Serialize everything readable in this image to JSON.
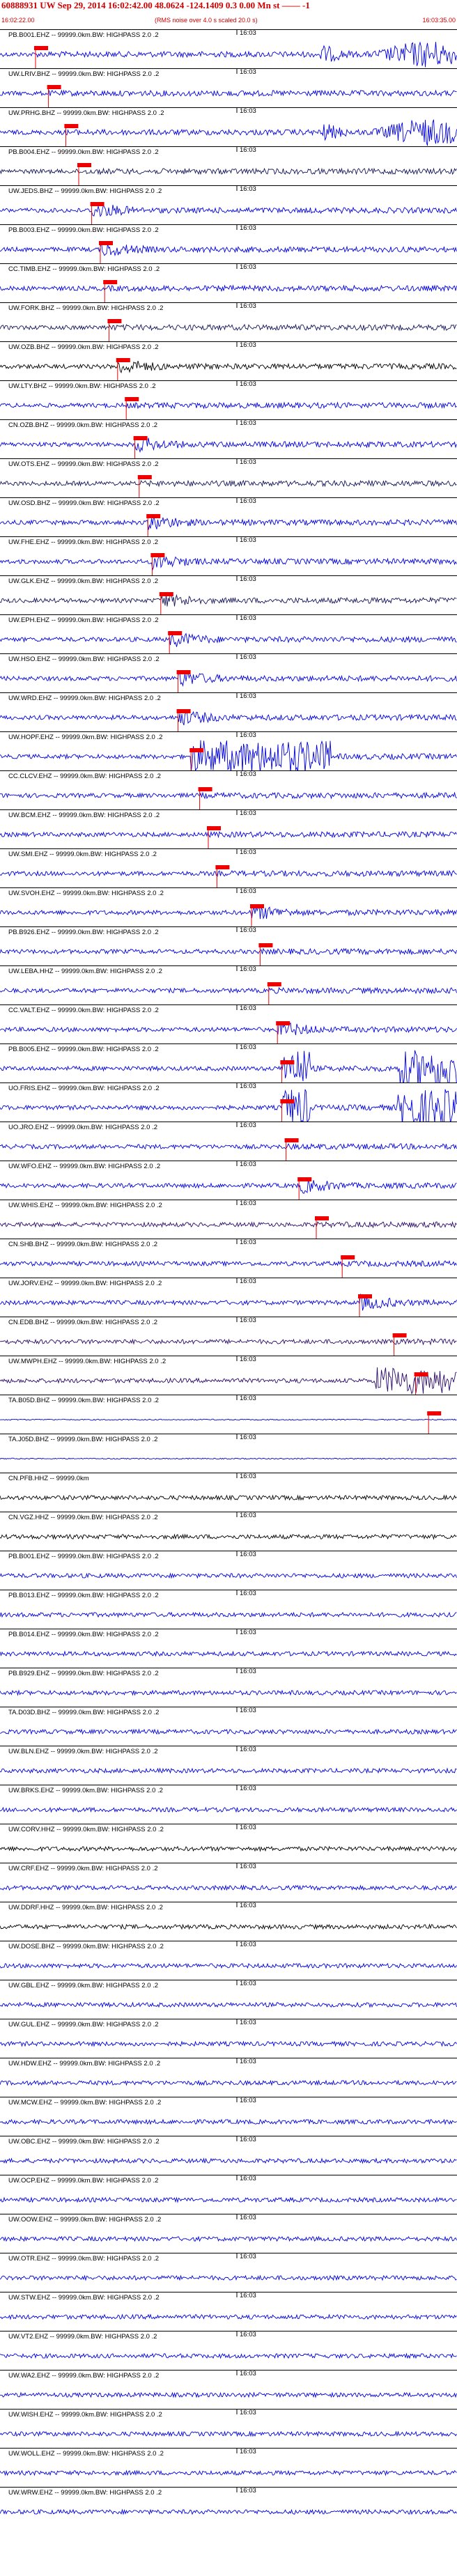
{
  "header": {
    "event_line": "60888931 UW Sep 29, 2014 16:02:42.00   48.0624 -124.1409  0.3 0.00 Mn st  —— -1",
    "right_mark": "-1",
    "start_time": "16:02:22.00",
    "note": "(RMS noise over 4.0 s scaled 20.0 s)",
    "end_time": "16:03:35.00"
  },
  "colors": {
    "header_red": "#cc0000",
    "pick_red": "#ee0000",
    "trace_blue": "#0000dd",
    "trace_navy": "#14145a",
    "trace_black": "#000000",
    "trace_purple": "#2a0a6a"
  },
  "traces": [
    {
      "label": "PB.B001.EHZ -- 99999.0km.BW: HIGHPASS 2.0 .2",
      "time": "16:03",
      "pick": 0.05,
      "color": "#0000dd",
      "activity": "strong-late"
    },
    {
      "label": "UW.LRIV.BHZ -- 99999.0km.BW: HIGHPASS 2.0 .2",
      "time": "16:03",
      "pick": 0.08,
      "color": "#0000dd",
      "activity": "noise"
    },
    {
      "label": "UW.PRHG.BHZ -- 99999.0km.BW: HIGHPASS 2.0 .2",
      "time": "16:03",
      "pick": 0.12,
      "color": "#0000dd",
      "activity": "strong-late"
    },
    {
      "label": "PB.B004.EHZ -- 99999.0km.BW: HIGHPASS 2.0 .2",
      "time": "16:03",
      "pick": 0.15,
      "color": "#14145a",
      "activity": "noise"
    },
    {
      "label": "UW.JEDS.BHZ -- 99999.0km.BW: HIGHPASS 2.0 .2",
      "time": "16:03",
      "pick": 0.18,
      "color": "#0000dd",
      "activity": "moderate"
    },
    {
      "label": "PB.B003.EHZ -- 99999.0km.BW: HIGHPASS 2.0 .2",
      "time": "16:03",
      "pick": 0.2,
      "color": "#0000dd",
      "activity": "moderate"
    },
    {
      "label": "CC.TIMB.EHZ -- 99999.0km.BW: HIGHPASS 2.0 .2",
      "time": "16:03",
      "pick": 0.21,
      "color": "#0000dd",
      "activity": "noise"
    },
    {
      "label": "UW.FORK.BHZ -- 99999.0km.BW: HIGHPASS 2.0 .2",
      "time": "16:03",
      "pick": 0.22,
      "color": "#14145a",
      "activity": "noise"
    },
    {
      "label": "UW.OZB.BHZ -- 99999.0km.BW: HIGHPASS 2.0 .2",
      "time": "16:03",
      "pick": 0.24,
      "color": "#000000",
      "activity": "moderate"
    },
    {
      "label": "UW.LTY.BHZ -- 99999.0km.BW: HIGHPASS 2.0 .2",
      "time": "16:03",
      "pick": 0.26,
      "color": "#0000dd",
      "activity": "noise"
    },
    {
      "label": "CN.OZB.BHZ -- 99999.0km.BW: HIGHPASS 2.0 .2",
      "time": "16:03",
      "pick": 0.28,
      "color": "#0000dd",
      "activity": "moderate"
    },
    {
      "label": "UW.OTS.EHZ -- 99999.0km.BW: HIGHPASS 2.0 .2",
      "time": "16:03",
      "pick": 0.29,
      "color": "#14145a",
      "activity": "noise"
    },
    {
      "label": "UW.OSD.BHZ -- 99999.0km.BW: HIGHPASS 2.0 .2",
      "time": "16:03",
      "pick": 0.31,
      "color": "#0000dd",
      "activity": "moderate"
    },
    {
      "label": "UW.FHE.EHZ -- 99999.0km.BW: HIGHPASS 2.0 .2",
      "time": "16:03",
      "pick": 0.32,
      "color": "#0000dd",
      "activity": "moderate"
    },
    {
      "label": "UW.GLK.EHZ -- 99999.0km.BW: HIGHPASS 2.0 .2",
      "time": "16:03",
      "pick": 0.34,
      "color": "#14145a",
      "activity": "moderate"
    },
    {
      "label": "UW.EPH.EHZ -- 99999.0km.BW: HIGHPASS 2.0 .2",
      "time": "16:03",
      "pick": 0.36,
      "color": "#0000dd",
      "activity": "moderate"
    },
    {
      "label": "UW.HSO.EHZ -- 99999.0km.BW: HIGHPASS 2.0 .2",
      "time": "16:03",
      "pick": 0.38,
      "color": "#0000dd",
      "activity": "moderate"
    },
    {
      "label": "UW.WRD.EHZ -- 99999.0km.BW: HIGHPASS 2.0 .2",
      "time": "16:03",
      "pick": 0.38,
      "color": "#0000dd",
      "activity": "moderate"
    },
    {
      "label": "UW.HOPF.EHZ -- 99999.0km.BW: HIGHPASS 2.0 .2",
      "time": "16:03",
      "pick": 0.41,
      "color": "#0000dd",
      "activity": "burst"
    },
    {
      "label": "CC.CLCV.EHZ -- 99999.0km.BW: HIGHPASS 2.0 .2",
      "time": "16:03",
      "pick": 0.43,
      "color": "#0000dd",
      "activity": "noise"
    },
    {
      "label": "UW.BCM.EHZ -- 99999.0km.BW: HIGHPASS 2.0 .2",
      "time": "16:03",
      "pick": 0.45,
      "color": "#0000dd",
      "activity": "noise"
    },
    {
      "label": "UW.SMI.EHZ -- 99999.0km.BW: HIGHPASS 2.0 .2",
      "time": "16:03",
      "pick": 0.47,
      "color": "#0000dd",
      "activity": "noise"
    },
    {
      "label": "UW.SVOH.EHZ -- 99999.0km.BW: HIGHPASS 2.0 .2",
      "time": "16:03",
      "pick": 0.55,
      "color": "#0000dd",
      "activity": "moderate"
    },
    {
      "label": "PB.B926.EHZ -- 99999.0km.BW: HIGHPASS 2.0 .2",
      "time": "16:03",
      "pick": 0.57,
      "color": "#0000dd",
      "activity": "noise"
    },
    {
      "label": "UW.LEBA.HHZ -- 99999.0km.BW: HIGHPASS 2.0 .2",
      "time": "16:03",
      "pick": 0.59,
      "color": "#0000dd",
      "activity": "noise"
    },
    {
      "label": "CC.VALT.EHZ -- 99999.0km.BW: HIGHPASS 2.0 .2",
      "time": "16:03",
      "pick": 0.61,
      "color": "#0000dd",
      "activity": "moderate"
    },
    {
      "label": "PB.B005.EHZ -- 99999.0km.BW: HIGHPASS 2.0 .2",
      "time": "16:03",
      "pick": 0.62,
      "color": "#0000dd",
      "activity": "clipped"
    },
    {
      "label": "UO.FRIS.EHZ -- 99999.0km.BW: HIGHPASS 2.0 .2",
      "time": "16:03",
      "pick": 0.62,
      "color": "#0000dd",
      "activity": "clipped"
    },
    {
      "label": "UO.JRO.EHZ -- 99999.0km.BW: HIGHPASS 2.0 .2",
      "time": "16:03",
      "pick": 0.63,
      "color": "#0000dd",
      "activity": "noise"
    },
    {
      "label": "UW.WFO.EHZ -- 99999.0km.BW: HIGHPASS 2.0 .2",
      "time": "16:03",
      "pick": 0.66,
      "color": "#0000dd",
      "activity": "moderate"
    },
    {
      "label": "UW.WHIS.EHZ -- 99999.0km.BW: HIGHPASS 2.0 .2",
      "time": "16:03",
      "pick": 0.7,
      "color": "#2a0a6a",
      "activity": "noise"
    },
    {
      "label": "CN.SHB.BHZ -- 99999.0km.BW: HIGHPASS 2.0 .2",
      "time": "16:03",
      "pick": 0.76,
      "color": "#0000dd",
      "activity": "noise"
    },
    {
      "label": "UW.JORV.EHZ -- 99999.0km.BW: HIGHPASS 2.0 .2",
      "time": "16:03",
      "pick": 0.8,
      "color": "#0000dd",
      "activity": "moderate"
    },
    {
      "label": "CN.EDB.BHZ -- 99999.0km.BW: HIGHPASS 2.0 .2",
      "time": "16:03",
      "pick": 0.88,
      "color": "#2a0a6a",
      "activity": "noise"
    },
    {
      "label": "UW.MWPH.EHZ -- 99999.0km.BW: HIGHPASS 2.0 .2",
      "time": "16:03",
      "pick": 0.93,
      "color": "#2a0a6a",
      "activity": "strong-late"
    },
    {
      "label": "TA.B05D.BHZ -- 99999.0km.BW: HIGHPASS 2.0 .2",
      "time": "16:03",
      "pick": 0.96,
      "color": "#0000dd",
      "activity": "flat"
    },
    {
      "label": "TA.J05D.BHZ -- 99999.0km.BW: HIGHPASS 2.0 .2",
      "time": "16:03",
      "pick": null,
      "color": "#0000dd",
      "activity": "flat"
    },
    {
      "label": "CN.PFB.HHZ -- 99999.0km",
      "time": "16:03",
      "pick": null,
      "color": "#000000",
      "activity": "noise"
    },
    {
      "label": "CN.VGZ.HHZ -- 99999.0km.BW: HIGHPASS 2.0 .2",
      "time": "16:03",
      "pick": null,
      "color": "#000000",
      "activity": "noise"
    },
    {
      "label": "PB.B001.EHZ -- 99999.0km.BW: HIGHPASS 2.0 .2",
      "time": "16:03",
      "pick": null,
      "color": "#0000dd",
      "activity": "noise"
    },
    {
      "label": "PB.B013.EHZ -- 99999.0km.BW: HIGHPASS 2.0 .2",
      "time": "16:03",
      "pick": null,
      "color": "#0000dd",
      "activity": "noise"
    },
    {
      "label": "PB.B014.EHZ -- 99999.0km.BW: HIGHPASS 2.0 .2",
      "time": "16:03",
      "pick": null,
      "color": "#0000dd",
      "activity": "noise"
    },
    {
      "label": "PB.B929.EHZ -- 99999.0km.BW: HIGHPASS 2.0 .2",
      "time": "16:03",
      "pick": null,
      "color": "#0000dd",
      "activity": "noise"
    },
    {
      "label": "TA.D03D.BHZ -- 99999.0km.BW: HIGHPASS 2.0 .2",
      "time": "16:03",
      "pick": null,
      "color": "#0000dd",
      "activity": "noise"
    },
    {
      "label": "UW.BLN.EHZ -- 99999.0km.BW: HIGHPASS 2.0 .2",
      "time": "16:03",
      "pick": null,
      "color": "#0000dd",
      "activity": "noise"
    },
    {
      "label": "UW.BRKS.EHZ -- 99999.0km.BW: HIGHPASS 2.0 .2",
      "time": "16:03",
      "pick": null,
      "color": "#0000dd",
      "activity": "noise"
    },
    {
      "label": "UW.CORV.HHZ -- 99999.0km.BW: HIGHPASS 2.0 .2",
      "time": "16:03",
      "pick": null,
      "color": "#000000",
      "activity": "noise"
    },
    {
      "label": "UW.CRF.EHZ -- 99999.0km.BW: HIGHPASS 2.0 .2",
      "time": "16:03",
      "pick": null,
      "color": "#0000dd",
      "activity": "noise"
    },
    {
      "label": "UW.DDRF.HHZ -- 99999.0km.BW: HIGHPASS 2.0 .2",
      "time": "16:03",
      "pick": null,
      "color": "#000000",
      "activity": "noise"
    },
    {
      "label": "UW.DOSE.BHZ -- 99999.0km.BW: HIGHPASS 2.0 .2",
      "time": "16:03",
      "pick": null,
      "color": "#0000dd",
      "activity": "noise"
    },
    {
      "label": "UW.GBL.EHZ -- 99999.0km.BW: HIGHPASS 2.0 .2",
      "time": "16:03",
      "pick": null,
      "color": "#0000dd",
      "activity": "noise"
    },
    {
      "label": "UW.GUL.EHZ -- 99999.0km.BW: HIGHPASS 2.0 .2",
      "time": "16:03",
      "pick": null,
      "color": "#0000dd",
      "activity": "noise"
    },
    {
      "label": "UW.HDW.EHZ -- 99999.0km.BW: HIGHPASS 2.0 .2",
      "time": "16:03",
      "pick": null,
      "color": "#0000dd",
      "activity": "noise"
    },
    {
      "label": "UW.MCW.EHZ -- 99999.0km.BW: HIGHPASS 2.0 .2",
      "time": "16:03",
      "pick": null,
      "color": "#0000dd",
      "activity": "noise"
    },
    {
      "label": "UW.OBC.EHZ -- 99999.0km.BW: HIGHPASS 2.0 .2",
      "time": "16:03",
      "pick": null,
      "color": "#0000dd",
      "activity": "noise"
    },
    {
      "label": "UW.OCP.EHZ -- 99999.0km.BW: HIGHPASS 2.0 .2",
      "time": "16:03",
      "pick": null,
      "color": "#0000dd",
      "activity": "noise"
    },
    {
      "label": "UW.OOW.EHZ -- 99999.0km.BW: HIGHPASS 2.0 .2",
      "time": "16:03",
      "pick": null,
      "color": "#0000dd",
      "activity": "noise"
    },
    {
      "label": "UW.OTR.EHZ -- 99999.0km.BW: HIGHPASS 2.0 .2",
      "time": "16:03",
      "pick": null,
      "color": "#0000dd",
      "activity": "noise"
    },
    {
      "label": "UW.STW.EHZ -- 99999.0km.BW: HIGHPASS 2.0 .2",
      "time": "16:03",
      "pick": null,
      "color": "#0000dd",
      "activity": "noise"
    },
    {
      "label": "UW.VT2.EHZ -- 99999.0km.BW: HIGHPASS 2.0 .2",
      "time": "16:03",
      "pick": null,
      "color": "#0000dd",
      "activity": "noise"
    },
    {
      "label": "UW.WA2.EHZ -- 99999.0km.BW: HIGHPASS 2.0 .2",
      "time": "16:03",
      "pick": null,
      "color": "#0000dd",
      "activity": "noise"
    },
    {
      "label": "UW.WISH.EHZ -- 99999.0km.BW: HIGHPASS 2.0 .2",
      "time": "16:03",
      "pick": null,
      "color": "#0000dd",
      "activity": "noise"
    },
    {
      "label": "UW.WOLL.EHZ -- 99999.0km.BW: HIGHPASS 2.0 .2",
      "time": "16:03",
      "pick": null,
      "color": "#0000dd",
      "activity": "noise"
    },
    {
      "label": "UW.WRW.EHZ -- 99999.0km.BW: HIGHPASS 2.0 .2",
      "time": "16:03",
      "pick": null,
      "color": "#0000dd",
      "activity": "noise"
    }
  ]
}
